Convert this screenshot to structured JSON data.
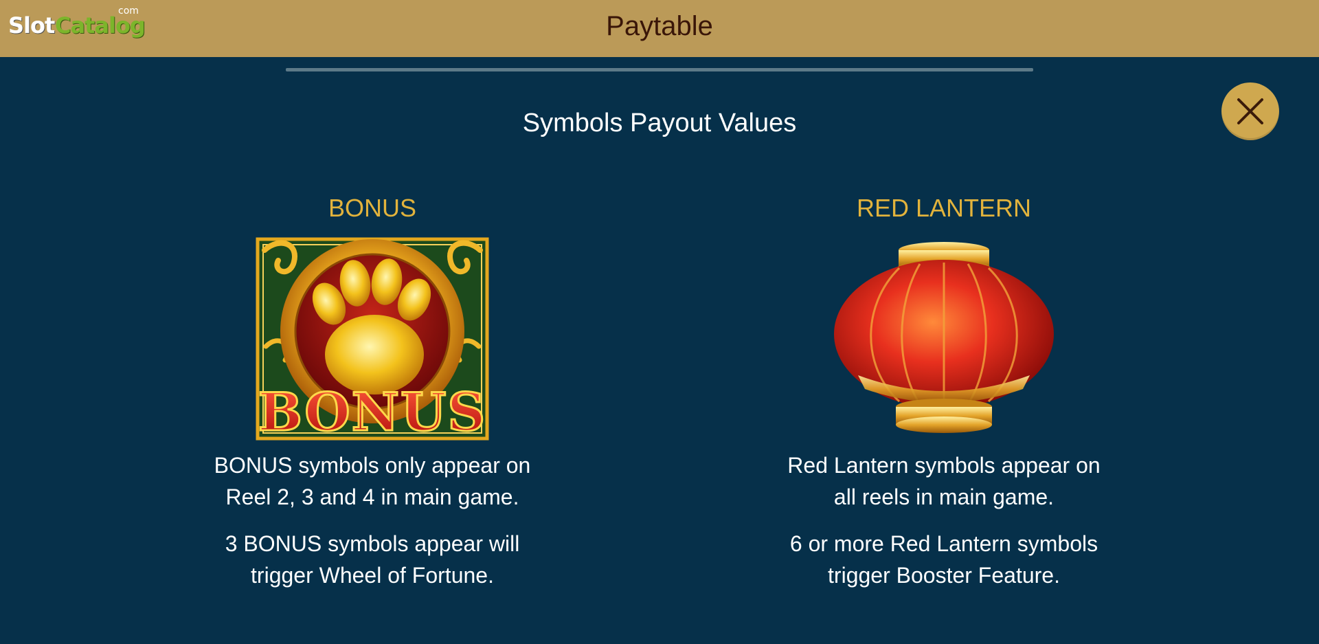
{
  "logo": {
    "part1": "Slot",
    "part2": "Catalog",
    "suffix": "com"
  },
  "header": {
    "title": "Paytable"
  },
  "close": {
    "icon": "close-icon"
  },
  "section": {
    "title": "Symbols Payout Values"
  },
  "symbols": [
    {
      "name": "BONUS",
      "art_text": "BONUS",
      "icon": "bonus-paw-icon",
      "desc1_line1": "BONUS symbols only appear on",
      "desc1_line2": "Reel 2, 3 and 4 in main game.",
      "desc2_line1": "3 BONUS symbols appear will",
      "desc2_line2": "trigger Wheel of Fortune."
    },
    {
      "name": "RED LANTERN",
      "icon": "red-lantern-icon",
      "desc1_line1": "Red Lantern symbols appear on",
      "desc1_line2": "all reels in main game.",
      "desc2_line1": "6 or more Red Lantern symbols",
      "desc2_line2": "trigger Booster Feature."
    }
  ],
  "colors": {
    "background": "#06304a",
    "header_bar": "#bb9a58",
    "symbol_name": "#e2b33c",
    "close_button": "#cfa84f"
  }
}
